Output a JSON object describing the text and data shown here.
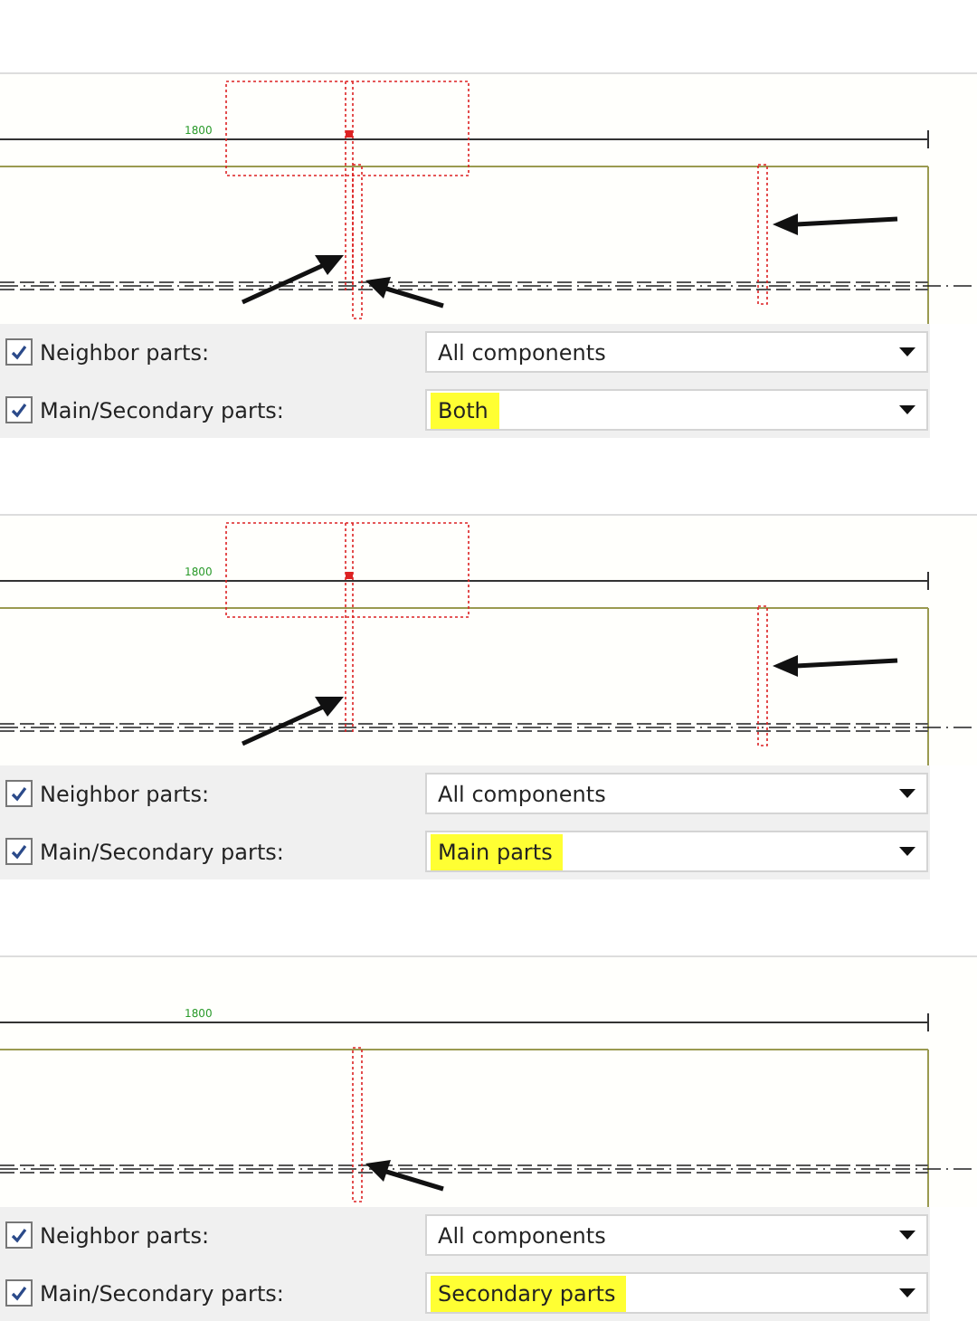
{
  "panels": [
    {
      "dimension": "1800",
      "markers": [
        {
          "kind": "bracket"
        },
        {
          "kind": "plate-left"
        },
        {
          "kind": "plate-right"
        }
      ],
      "rows": [
        {
          "label": "Neighbor parts:",
          "checked": true,
          "value": "All components",
          "highlighted": false
        },
        {
          "label": "Main/Secondary parts:",
          "checked": true,
          "value": "Both",
          "highlighted": true
        }
      ]
    },
    {
      "dimension": "1800",
      "markers": [
        {
          "kind": "bracket"
        },
        {
          "kind": "plate-right"
        }
      ],
      "rows": [
        {
          "label": "Neighbor parts:",
          "checked": true,
          "value": "All components",
          "highlighted": false
        },
        {
          "label": "Main/Secondary parts:",
          "checked": true,
          "value": "Main parts",
          "highlighted": true
        }
      ]
    },
    {
      "dimension": "1800",
      "markers": [
        {
          "kind": "plate-left"
        }
      ],
      "rows": [
        {
          "label": "Neighbor parts:",
          "checked": true,
          "value": "All components",
          "highlighted": false
        },
        {
          "label": "Main/Secondary parts:",
          "checked": true,
          "value": "Secondary parts",
          "highlighted": true
        }
      ]
    }
  ]
}
